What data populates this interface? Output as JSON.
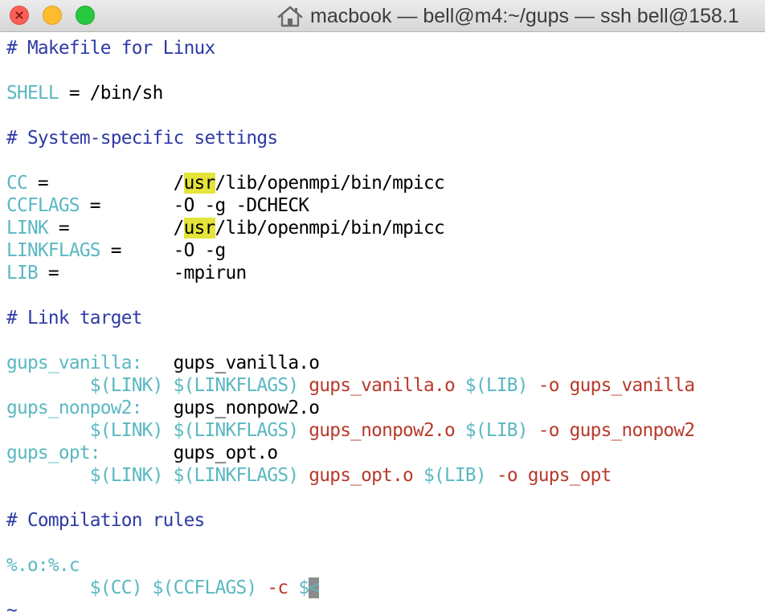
{
  "window": {
    "title": "macbook — bell@m4:~/gups — ssh bell@158.1",
    "icon": "house-icon",
    "colors": {
      "close": "#fc5f57",
      "minimize": "#fdbc2e",
      "maximize": "#28c840",
      "comment": "#2e3aa5",
      "target": "#5ab8c2",
      "recipe": "#b8392b",
      "highlight": "#e4e43a"
    }
  },
  "editor": {
    "l1": "# Makefile for Linux",
    "l3": {
      "name": "SHELL",
      "rest": " = /bin/sh"
    },
    "l5": "# System-specific settings",
    "l7": {
      "name": "CC",
      "rest": " =            /",
      "hl": "usr",
      "tail": "/lib/openmpi/bin/mpicc"
    },
    "l8": {
      "name": "CCFLAGS",
      "rest": " =       -O -g -DCHECK"
    },
    "l9": {
      "name": "LINK",
      "rest": " =          /",
      "hl": "usr",
      "tail": "/lib/openmpi/bin/mpicc"
    },
    "l10": {
      "name": "LINKFLAGS",
      "rest": " =     -O -g"
    },
    "l11": {
      "name": "LIB",
      "rest": " =           -mpirun"
    },
    "l13": "# Link target",
    "l15": {
      "target": "gups_vanilla:",
      "deps": "   gups_vanilla.o"
    },
    "l16": {
      "vars": "        $(LINK) $(LINKFLAGS) ",
      "obj": "gups_vanilla.o ",
      "lib": "$(LIB) ",
      "out": "-o gups_vanilla"
    },
    "l17": {
      "target": "gups_nonpow2:",
      "deps": "   gups_nonpow2.o"
    },
    "l18": {
      "vars": "        $(LINK) $(LINKFLAGS) ",
      "obj": "gups_nonpow2.o ",
      "lib": "$(LIB) ",
      "out": "-o gups_nonpow2"
    },
    "l19": {
      "target": "gups_opt:",
      "deps": "       gups_opt.o"
    },
    "l20": {
      "vars": "        $(LINK) $(LINKFLAGS) ",
      "obj": "gups_opt.o ",
      "lib": "$(LIB) ",
      "out": "-o gups_opt"
    },
    "l22": "# Compilation rules",
    "l24": {
      "pattern": "%.o:%.c"
    },
    "l25": {
      "vars": "        $(CC) $(CCFLAGS) ",
      "flag": "-c ",
      "auto": "$",
      "cursor": "<"
    },
    "l26": "~"
  }
}
